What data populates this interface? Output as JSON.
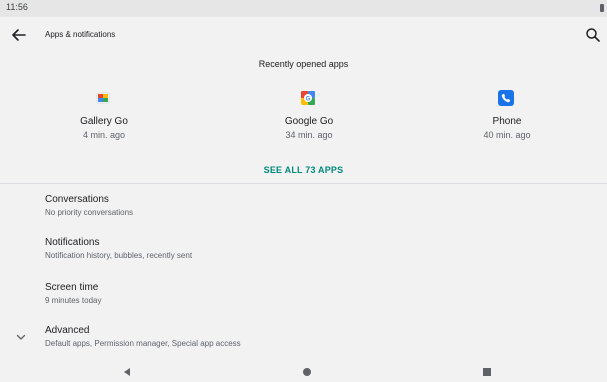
{
  "status_bar": {
    "time": "11:56"
  },
  "app_bar": {
    "title": "Apps & notifications"
  },
  "recent": {
    "header": "Recently opened apps",
    "apps": [
      {
        "name": "Gallery Go",
        "time": "4 min. ago",
        "icon": "gallery-go-icon"
      },
      {
        "name": "Google Go",
        "time": "34 min. ago",
        "icon": "google-go-icon"
      },
      {
        "name": "Phone",
        "time": "40 min. ago",
        "icon": "phone-icon"
      }
    ],
    "see_all": "SEE ALL 73 APPS"
  },
  "prefs": [
    {
      "title": "Conversations",
      "summary": "No priority conversations"
    },
    {
      "title": "Notifications",
      "summary": "Notification history, bubbles, recently sent"
    },
    {
      "title": "Screen time",
      "summary": "9 minutes today"
    },
    {
      "title": "Advanced",
      "summary": "Default apps, Permission manager, Special app access"
    }
  ],
  "colors": {
    "accent": "#00897b",
    "background": "#f2f2f2",
    "phone_blue": "#1a73e8"
  }
}
